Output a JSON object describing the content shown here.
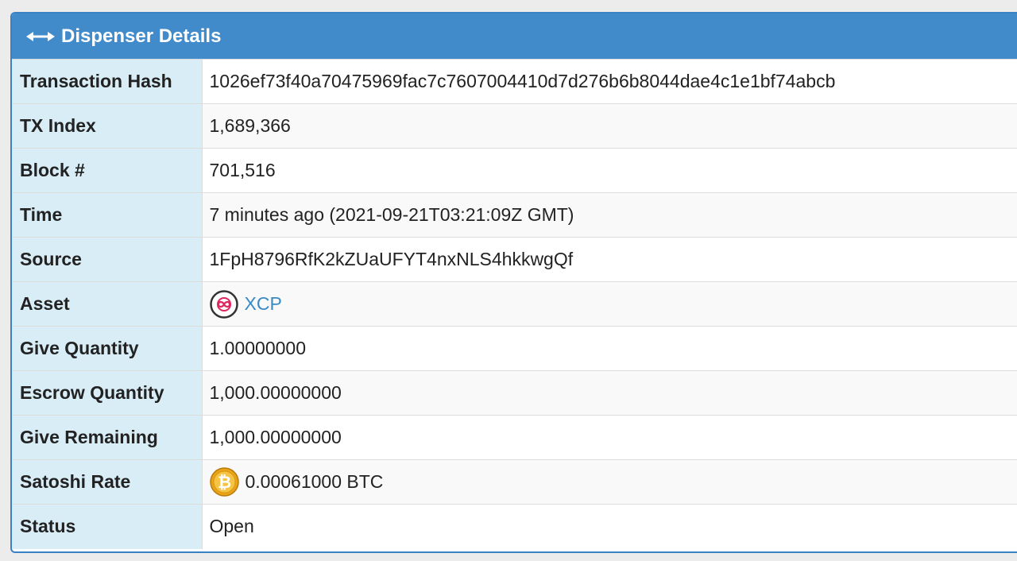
{
  "panel": {
    "title": "Dispenser Details"
  },
  "rows": [
    {
      "label": "Transaction Hash",
      "value": "1026ef73f40a70475969fac7c7607004410d7d276b6b8044dae4c1e1bf74abcb"
    },
    {
      "label": "TX Index",
      "value": "1,689,366"
    },
    {
      "label": "Block #",
      "value": "701,516"
    },
    {
      "label": "Time",
      "value": "7 minutes ago (2021-09-21T03:21:09Z GMT)"
    },
    {
      "label": "Source",
      "value": "1FpH8796RfK2kZUaUFYT4nxNLS4hkkwgQf"
    },
    {
      "label": "Asset",
      "value": "XCP",
      "icon": "xcp-coin-icon"
    },
    {
      "label": "Give Quantity",
      "value": "1.00000000"
    },
    {
      "label": "Escrow Quantity",
      "value": "1,000.00000000"
    },
    {
      "label": "Give Remaining",
      "value": "1,000.00000000"
    },
    {
      "label": "Satoshi Rate",
      "value": "0.00061000 BTC",
      "icon": "bitcoin-icon"
    },
    {
      "label": "Status",
      "value": "Open"
    }
  ],
  "colors": {
    "header_bg": "#428bca",
    "label_bg": "#d9edf7",
    "link": "#3a8ac4",
    "bitcoin": "#f2a900",
    "xcp": "#e0245e"
  }
}
